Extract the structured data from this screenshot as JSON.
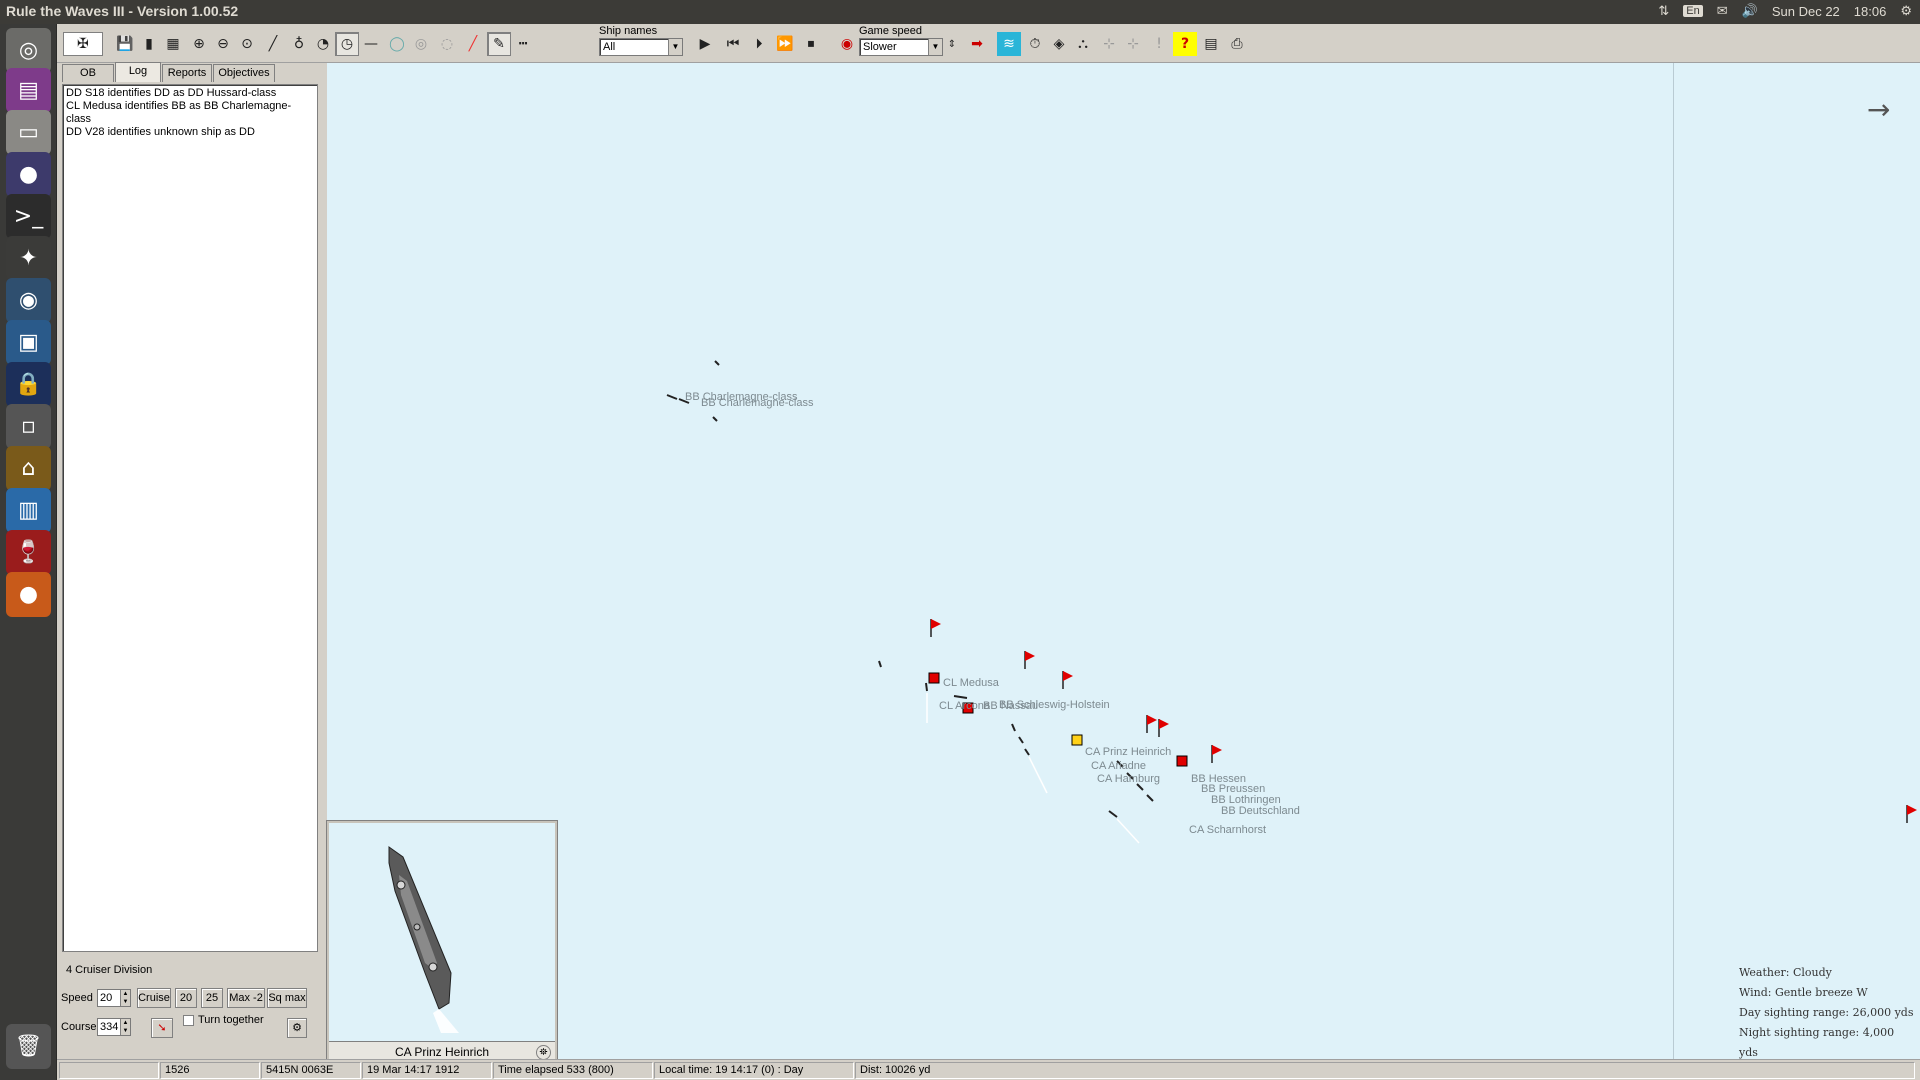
{
  "window": {
    "title": "Rule the Waves III - Version 1.00.52"
  },
  "tray": {
    "keyboard": "En",
    "date": "Sun Dec 22",
    "time": "18:06"
  },
  "toolbar": {
    "ship_names_label": "Ship names",
    "ship_names_value": "All",
    "game_speed_label": "Game speed",
    "game_speed_value": "Slower"
  },
  "tabs": [
    "OB",
    "Log",
    "Reports",
    "Objectives"
  ],
  "log": [
    "DD S18 identifies DD as DD Hussard-class",
    "CL Medusa identifies BB as BB Charlemagne-class",
    "DD V28 identifies unknown ship as DD"
  ],
  "division": {
    "label": "4 Cruiser Division",
    "speed_label": "Speed",
    "speed_value": "20",
    "cruise_label": "Cruise",
    "btn_20": "20",
    "btn_25": "25",
    "btn_max2": "Max -2",
    "btn_sqmax": "Sq max",
    "course_label": "Course",
    "course_value": "334",
    "turn_together_label": "Turn together"
  },
  "map": {
    "enemy_labels": [
      "BB Charlemagne-class",
      "BB Charlemagne-class"
    ],
    "ship_labels": [
      "CL Medusa",
      "CL Arcona",
      "BB Nassau",
      "BB Schleswig-Holstein",
      "CA Prinz Heinrich",
      "CA Ariadne",
      "CA Hamburg",
      "BB Hessen",
      "BB Preussen",
      "BB Lothringen",
      "BB Deutschland",
      "CA Scharnhorst"
    ],
    "weather": {
      "weather": "Weather: Cloudy",
      "wind": "Wind: Gentle breeze  W",
      "day_range": "Day sighting range: 26,000 yds",
      "night_range": "Night sighting range: 4,000 yds"
    }
  },
  "preview": {
    "ship_name": "CA Prinz Heinrich"
  },
  "status": {
    "year": "1526",
    "position": "5415N 0063E",
    "date": "19 Mar 14:17 1912",
    "elapsed": "Time elapsed 533 (800)",
    "local_time": "Local time: 19 14:17 (0) : Day",
    "distance": "Dist: 10026 yd"
  }
}
